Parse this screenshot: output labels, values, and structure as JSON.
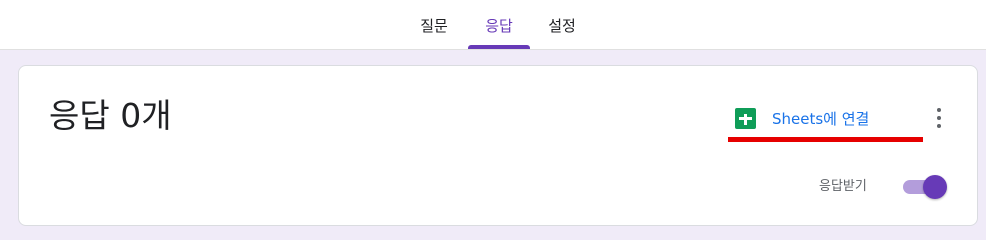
{
  "tabs": [
    {
      "label": "질문",
      "active": false
    },
    {
      "label": "응답",
      "active": true
    },
    {
      "label": "설정",
      "active": false
    }
  ],
  "accent_color": "#673ab7",
  "responses": {
    "title": "응답 0개",
    "sheets_button_label": "Sheets에 연결",
    "sheets_icon": "google-sheets-icon",
    "more_icon": "more-vert-icon",
    "accepting_label": "응답받기",
    "accepting_on": true
  },
  "annotation": {
    "color": "#e60000"
  }
}
